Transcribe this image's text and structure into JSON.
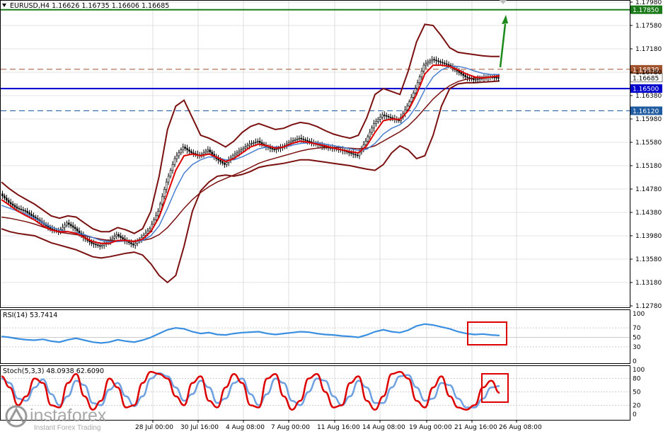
{
  "chart_data": {
    "type": "line",
    "symbol_header": "EURUSD,H4  1.16626 1.16735 1.16606 1.16685",
    "price_ticks": [
      "1.17980",
      "1.17580",
      "1.17180",
      "1.16780",
      "1.16380",
      "1.15980",
      "1.15580",
      "1.15180",
      "1.14780",
      "1.14380",
      "1.13980",
      "1.13580",
      "1.13180",
      "1.12780"
    ],
    "price_range": [
      1.1278,
      1.1798
    ],
    "levels": [
      {
        "label": "1.17850",
        "value": 1.1785,
        "color": "#1a7a1a",
        "style": "solid"
      },
      {
        "label": "1.16830",
        "value": 1.1683,
        "color": "#a0522d",
        "style": "dashed"
      },
      {
        "label": "1.16685",
        "value": 1.16685,
        "color": "#000000",
        "style": "current"
      },
      {
        "label": "1.16500",
        "value": 1.165,
        "color": "#0000cc",
        "style": "solid"
      },
      {
        "label": "1.16120",
        "value": 1.1612,
        "color": "#1e5aa0",
        "style": "dashed"
      }
    ],
    "date_labels": [
      "28 Jul 00:00",
      "30 Jul 16:00",
      "4 Aug 08:00",
      "7 Aug 00:00",
      "11 Aug 16:00",
      "14 Aug 08:00",
      "19 Aug 00:00",
      "21 Aug 16:00",
      "26 Aug 08:00"
    ],
    "price_series": [
      1.147,
      1.1455,
      1.1445,
      1.144,
      1.143,
      1.142,
      1.141,
      1.1405,
      1.142,
      1.141,
      1.1395,
      1.1385,
      1.138,
      1.1388,
      1.14,
      1.139,
      1.1382,
      1.1395,
      1.141,
      1.144,
      1.149,
      1.153,
      1.155,
      1.154,
      1.1535,
      1.1545,
      1.153,
      1.152,
      1.1535,
      1.1545,
      1.1555,
      1.156,
      1.155,
      1.1545,
      1.155,
      1.156,
      1.1565,
      1.156,
      1.1555,
      1.155,
      1.1548,
      1.1545,
      1.154,
      1.1535,
      1.156,
      1.159,
      1.1605,
      1.16,
      1.1595,
      1.162,
      1.165,
      1.169,
      1.17,
      1.1695,
      1.169,
      1.168,
      1.167,
      1.1665,
      1.1668,
      1.167,
      1.16685
    ],
    "ma_red": [
      1.146,
      1.145,
      1.144,
      1.1432,
      1.1425,
      1.1415,
      1.1408,
      1.1405,
      1.1405,
      1.1402,
      1.1395,
      1.1388,
      1.1385,
      1.1385,
      1.139,
      1.139,
      1.1388,
      1.1392,
      1.1405,
      1.143,
      1.147,
      1.151,
      1.1535,
      1.1538,
      1.1535,
      1.1538,
      1.1532,
      1.1525,
      1.153,
      1.154,
      1.155,
      1.1555,
      1.1552,
      1.1548,
      1.155,
      1.1556,
      1.156,
      1.1558,
      1.1555,
      1.1552,
      1.1548,
      1.1545,
      1.1542,
      1.154,
      1.1552,
      1.1575,
      1.1595,
      1.1598,
      1.1597,
      1.1612,
      1.164,
      1.1675,
      1.169,
      1.169,
      1.1688,
      1.1682,
      1.1675,
      1.167,
      1.1668,
      1.167,
      1.1672
    ],
    "ma_blue": [
      1.145,
      1.1445,
      1.144,
      1.1435,
      1.1428,
      1.142,
      1.1413,
      1.1408,
      1.1405,
      1.1403,
      1.14,
      1.1395,
      1.139,
      1.1388,
      1.1388,
      1.1389,
      1.1388,
      1.139,
      1.1398,
      1.1415,
      1.1445,
      1.1478,
      1.1505,
      1.152,
      1.1528,
      1.1533,
      1.1532,
      1.1528,
      1.1528,
      1.1533,
      1.154,
      1.1547,
      1.155,
      1.155,
      1.155,
      1.1553,
      1.1556,
      1.1557,
      1.1557,
      1.1555,
      1.1552,
      1.155,
      1.1547,
      1.1544,
      1.1546,
      1.1556,
      1.1572,
      1.1582,
      1.1588,
      1.16,
      1.162,
      1.1648,
      1.167,
      1.1682,
      1.1688,
      1.1688,
      1.1685,
      1.168,
      1.1676,
      1.1674,
      1.1674
    ],
    "ma_dark": [
      1.143,
      1.1428,
      1.1425,
      1.1422,
      1.1418,
      1.1413,
      1.1408,
      1.1404,
      1.1402,
      1.14,
      1.1398,
      1.1395,
      1.1392,
      1.139,
      1.1389,
      1.1389,
      1.1389,
      1.139,
      1.1393,
      1.14,
      1.1412,
      1.1428,
      1.1445,
      1.146,
      1.1472,
      1.1482,
      1.149,
      1.1496,
      1.1502,
      1.1508,
      1.1515,
      1.1522,
      1.1527,
      1.1531,
      1.1535,
      1.1539,
      1.1543,
      1.1546,
      1.1548,
      1.1549,
      1.1549,
      1.1549,
      1.1548,
      1.1547,
      1.1548,
      1.1552,
      1.156,
      1.1568,
      1.1576,
      1.1586,
      1.16,
      1.1616,
      1.1632,
      1.1645,
      1.1655,
      1.1662,
      1.1666,
      1.1668,
      1.1669,
      1.167,
      1.1671
    ],
    "bb_upper": [
      1.149,
      1.1478,
      1.1468,
      1.146,
      1.1452,
      1.1442,
      1.1432,
      1.1428,
      1.1432,
      1.143,
      1.142,
      1.141,
      1.1405,
      1.1405,
      1.1412,
      1.1408,
      1.1402,
      1.141,
      1.144,
      1.15,
      1.158,
      1.162,
      1.163,
      1.16,
      1.157,
      1.1565,
      1.1558,
      1.155,
      1.156,
      1.1575,
      1.1585,
      1.159,
      1.1585,
      1.158,
      1.1582,
      1.1588,
      1.1592,
      1.159,
      1.1585,
      1.1578,
      1.1572,
      1.1568,
      1.1565,
      1.157,
      1.16,
      1.164,
      1.165,
      1.1645,
      1.164,
      1.168,
      1.173,
      1.176,
      1.1758,
      1.174,
      1.172,
      1.1712,
      1.171,
      1.1708,
      1.1706,
      1.1705,
      1.1705
    ],
    "bb_lower": [
      1.141,
      1.1405,
      1.1402,
      1.14,
      1.1398,
      1.1392,
      1.1386,
      1.1382,
      1.1378,
      1.1374,
      1.1368,
      1.1362,
      1.136,
      1.1362,
      1.1365,
      1.1368,
      1.137,
      1.1365,
      1.135,
      1.133,
      1.1318,
      1.133,
      1.138,
      1.144,
      1.1475,
      1.149,
      1.15,
      1.1502,
      1.15,
      1.1503,
      1.1508,
      1.1515,
      1.1518,
      1.152,
      1.1522,
      1.1525,
      1.1528,
      1.1528,
      1.1526,
      1.1524,
      1.1522,
      1.152,
      1.1518,
      1.1515,
      1.1512,
      1.151,
      1.152,
      1.154,
      1.1552,
      1.1545,
      1.153,
      1.1535,
      1.157,
      1.162,
      1.165,
      1.1658,
      1.166,
      1.166,
      1.1661,
      1.1662,
      1.1663
    ],
    "rsi": {
      "header": "RSI(14) 53.7414",
      "ticks": [
        "100",
        "70",
        "50",
        "30",
        "0"
      ],
      "range": [
        0,
        100
      ],
      "values": [
        52,
        50,
        47,
        45,
        44,
        46,
        42,
        40,
        45,
        48,
        44,
        40,
        38,
        40,
        45,
        42,
        40,
        44,
        50,
        58,
        66,
        70,
        68,
        62,
        58,
        60,
        56,
        55,
        58,
        60,
        61,
        62,
        58,
        56,
        58,
        60,
        62,
        61,
        58,
        56,
        55,
        53,
        52,
        50,
        55,
        62,
        66,
        62,
        60,
        65,
        74,
        78,
        76,
        72,
        68,
        62,
        58,
        56,
        57,
        55,
        54
      ]
    },
    "stoch": {
      "header": "Stoch(5,3,3) 48.0938 62.6090",
      "ticks": [
        "100",
        "80",
        "50",
        "20",
        "0"
      ],
      "range": [
        0,
        100
      ],
      "main": [
        85,
        60,
        20,
        40,
        80,
        70,
        20,
        15,
        70,
        90,
        40,
        10,
        30,
        80,
        60,
        15,
        20,
        70,
        95,
        90,
        80,
        40,
        20,
        70,
        85,
        30,
        15,
        60,
        90,
        70,
        20,
        15,
        80,
        90,
        40,
        10,
        30,
        80,
        90,
        50,
        15,
        20,
        70,
        85,
        30,
        10,
        40,
        90,
        95,
        80,
        30,
        15,
        60,
        85,
        40,
        15,
        10,
        20,
        60,
        75,
        48
      ],
      "signal": [
        80,
        70,
        35,
        30,
        60,
        78,
        45,
        20,
        40,
        75,
        65,
        25,
        20,
        55,
        70,
        40,
        18,
        40,
        80,
        92,
        85,
        60,
        30,
        45,
        75,
        60,
        25,
        35,
        70,
        80,
        45,
        20,
        45,
        80,
        70,
        30,
        20,
        50,
        80,
        75,
        40,
        20,
        40,
        75,
        60,
        25,
        25,
        60,
        85,
        88,
        60,
        30,
        35,
        70,
        65,
        35,
        15,
        15,
        35,
        60,
        63
      ]
    }
  },
  "watermark": {
    "brand": "instaforex",
    "tagline": "Instant Forex Trading"
  },
  "colors": {
    "grid": "#c8c8c8",
    "candle": "#000000",
    "ma_red": "#dd0000",
    "ma_blue": "#4a7fd0",
    "ma_dark": "#7a1010",
    "bb": "#7a1010",
    "rsi_line": "#3a8fe0",
    "stoch_main": "#dd0000",
    "stoch_signal": "#6fa0e0",
    "arrow": "#1a8a1a",
    "box": "#dd0000"
  }
}
